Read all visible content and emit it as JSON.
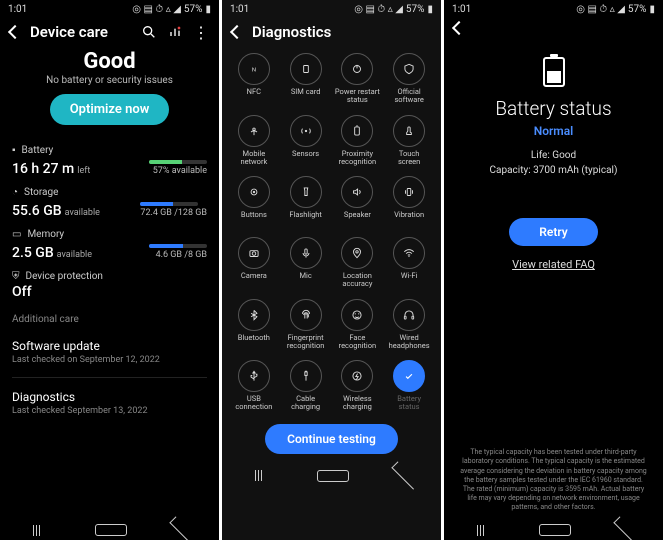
{
  "status_bar": {
    "time": "1:01",
    "icons": "◎ ⦿ ▵ ⋮",
    "signal": "📶",
    "batt_pct": "57%",
    "batt_icon": "🔋"
  },
  "p1": {
    "title": "Device care",
    "hero": {
      "status": "Good",
      "sub": "No battery or security issues",
      "btn": "Optimize now"
    },
    "battery": {
      "label": "Battery",
      "value": "16 h 27 m",
      "sub": "left",
      "pct": "57% available",
      "bar_fill": 57,
      "bar_color": "#57d276"
    },
    "storage": {
      "label": "Storage",
      "value": "55.6 GB",
      "sub": "available",
      "pct": "72.4 GB /128 GB",
      "bar_fill": 57,
      "bar_color": "#2e7bff"
    },
    "memory": {
      "label": "Memory",
      "value": "2.5 GB",
      "sub": "available",
      "pct": "4.6 GB /8 GB",
      "bar_fill": 58,
      "bar_color": "#2e7bff"
    },
    "protection": {
      "label": "Device protection",
      "value": "Off"
    },
    "additional_title": "Additional care",
    "software": {
      "title": "Software update",
      "sub": "Last checked on September 12, 2022"
    },
    "diagnostics": {
      "title": "Diagnostics",
      "sub": "Last checked September 13, 2022"
    }
  },
  "p2": {
    "title": "Diagnostics",
    "btn": "Continue testing",
    "items": [
      {
        "id": "nfc",
        "label": "NFC"
      },
      {
        "id": "sim",
        "label": "SIM card"
      },
      {
        "id": "power-restart",
        "label": "Power restart\nstatus"
      },
      {
        "id": "official-sw",
        "label": "Official\nsoftware"
      },
      {
        "id": "mobile-net",
        "label": "Mobile\nnetwork"
      },
      {
        "id": "sensors",
        "label": "Sensors"
      },
      {
        "id": "proximity",
        "label": "Proximity\nrecognition"
      },
      {
        "id": "touch",
        "label": "Touch\nscreen"
      },
      {
        "id": "buttons",
        "label": "Buttons"
      },
      {
        "id": "flashlight",
        "label": "Flashlight"
      },
      {
        "id": "speaker",
        "label": "Speaker"
      },
      {
        "id": "vibration",
        "label": "Vibration"
      },
      {
        "id": "camera",
        "label": "Camera"
      },
      {
        "id": "mic",
        "label": "Mic"
      },
      {
        "id": "location",
        "label": "Location\naccuracy"
      },
      {
        "id": "wifi",
        "label": "Wi-Fi"
      },
      {
        "id": "bluetooth",
        "label": "Bluetooth"
      },
      {
        "id": "fingerprint",
        "label": "Fingerprint\nrecognition"
      },
      {
        "id": "face",
        "label": "Face\nrecognition"
      },
      {
        "id": "headphones",
        "label": "Wired\nheadphones"
      },
      {
        "id": "usb",
        "label": "USB\nconnection"
      },
      {
        "id": "cable-chg",
        "label": "Cable\ncharging"
      },
      {
        "id": "wireless-chg",
        "label": "Wireless\ncharging"
      },
      {
        "id": "battery-status",
        "label": "Battery\nstatus",
        "done": true
      }
    ]
  },
  "p3": {
    "title": "Battery status",
    "status": "Normal",
    "life": "Life: Good",
    "capacity": "Capacity: 3700 mAh (typical)",
    "retry": "Retry",
    "faq": "View related FAQ",
    "fine": "The typical capacity has been tested under third-party laboratory conditions. The typical capacity is the estimated average considering the deviation in battery capacity among the battery samples tested under the IEC 61960 standard. The rated (minimum) capacity is 3595 mAh. Actual battery life may vary depending on network environment, usage patterns, and other factors."
  }
}
